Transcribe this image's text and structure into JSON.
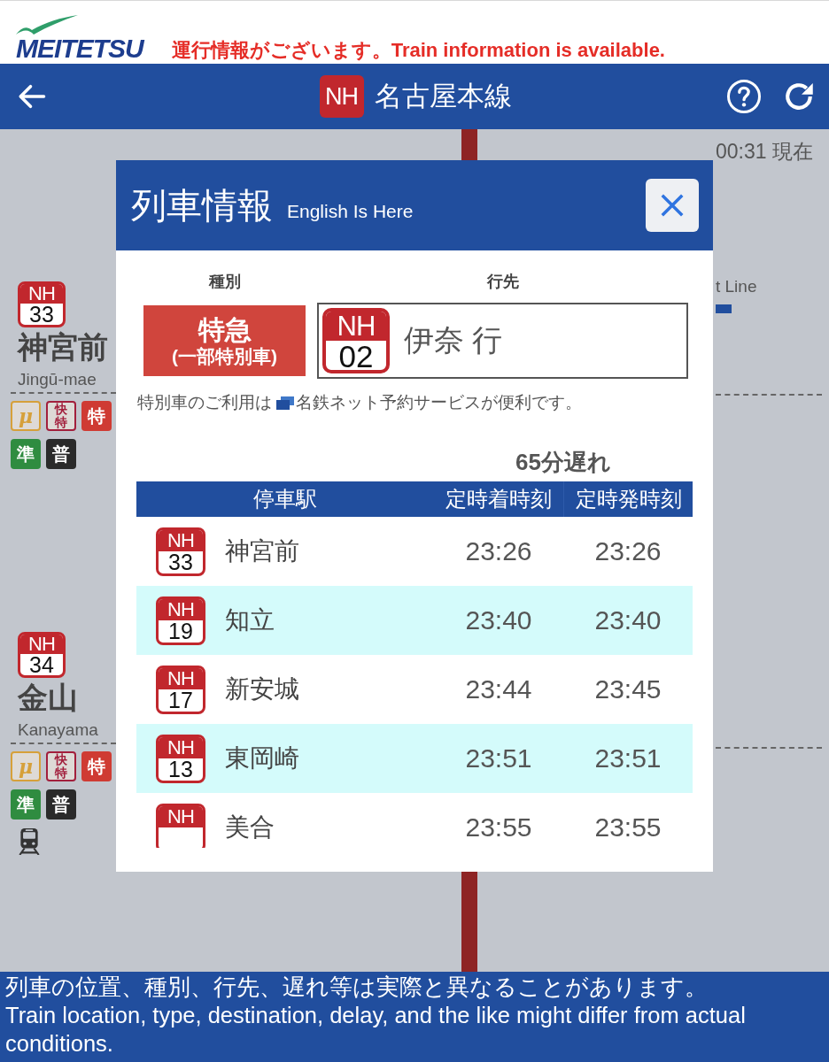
{
  "top_bar": {
    "logo_text": "MEITETSU",
    "alert": "運行情報がございます。Train information is available."
  },
  "header": {
    "line_code": "NH",
    "line_name": "名古屋本線"
  },
  "map": {
    "updated_time": "00:31 現在",
    "stations": [
      {
        "code": "NH",
        "number": "33",
        "name": "神宮前",
        "name_en": "Jingū-mae",
        "services": [
          {
            "label": "μ",
            "kind": "script",
            "color": "#d6a03a"
          },
          {
            "label": "快特",
            "kind": "stacked",
            "color": "#a21f3c"
          },
          {
            "label": "特",
            "kind": "filled",
            "color": "#cf3b33"
          },
          {
            "label": "準",
            "kind": "filled",
            "color": "#2f8c40"
          },
          {
            "label": "普",
            "kind": "filled",
            "color": "#2a2a2a"
          }
        ],
        "train_here": false
      },
      {
        "code": "NH",
        "number": "34",
        "name": "金山",
        "name_en": "Kanayama",
        "services": [
          {
            "label": "μ",
            "kind": "script",
            "color": "#d6a03a"
          },
          {
            "label": "快特",
            "kind": "stacked",
            "color": "#a21f3c"
          },
          {
            "label": "特",
            "kind": "filled",
            "color": "#cf3b33"
          },
          {
            "label": "準",
            "kind": "filled",
            "color": "#2f8c40"
          },
          {
            "label": "普",
            "kind": "filled",
            "color": "#2a2a2a"
          }
        ],
        "train_here": true
      }
    ],
    "side_line": "t Line"
  },
  "modal": {
    "title": "列車情報",
    "subtitle": "English Is Here",
    "type_label": "種別",
    "destination_label": "行先",
    "train_type": {
      "name": "特急",
      "detail": "(一部特別車)"
    },
    "destination": {
      "code": "NH",
      "number": "02",
      "name": "伊奈 行"
    },
    "note": {
      "lead": "特別車のご利用は",
      "service": "名鉄ネット予約サービスが便利です。"
    },
    "delay": "65分遅れ",
    "table": {
      "columns": [
        "停車駅",
        "定時着時刻",
        "定時発時刻"
      ],
      "rows": [
        {
          "code": "NH",
          "number": "33",
          "station": "神宮前",
          "arrival": "23:26",
          "departure": "23:26"
        },
        {
          "code": "NH",
          "number": "19",
          "station": "知立",
          "arrival": "23:40",
          "departure": "23:40"
        },
        {
          "code": "NH",
          "number": "17",
          "station": "新安城",
          "arrival": "23:44",
          "departure": "23:45"
        },
        {
          "code": "NH",
          "number": "13",
          "station": "東岡崎",
          "arrival": "23:51",
          "departure": "23:51"
        },
        {
          "code": "NH",
          "station": "美合",
          "arrival": "23:55",
          "departure": "23:55"
        }
      ]
    }
  },
  "footer": {
    "notice_ja": "列車の位置、種別、行先、遅れ等は実際と異なることがあります。",
    "notice_en": "Train location, type, destination, delay, and the like might differ from actual conditions."
  }
}
